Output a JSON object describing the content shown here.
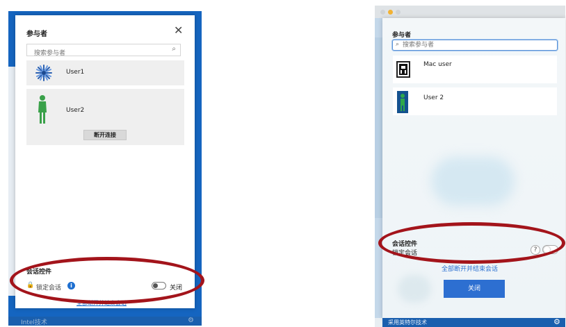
{
  "windows_panel": {
    "title": "参与者",
    "close_glyph": "✕",
    "search": {
      "placeholder": "搜索参与者"
    },
    "participants": [
      {
        "name": "User1",
        "avatar": "snowflake-icon"
      },
      {
        "name": "User2",
        "avatar": "person-icon"
      }
    ],
    "disconnect_label": "断开连接",
    "session_controls": {
      "title": "会话控件",
      "lock_label": "锁定会话",
      "toggle_state": "关闭",
      "end_all_label": "全部断开并结束会话"
    },
    "footer_text": "Intel技术",
    "accent_color": "#1565c0"
  },
  "mac_panel": {
    "title": "参与者",
    "search": {
      "placeholder": "搜索参与者"
    },
    "participants": [
      {
        "name": "Mac user",
        "avatar": "cafe-sign-icon"
      },
      {
        "name": "User 2",
        "avatar": "person-icon"
      }
    ],
    "session_controls": {
      "title": "会话控件",
      "lock_label": "锁定会话",
      "help_glyph": "?",
      "end_all_label": "全部断开并结束会话"
    },
    "close_label": "关闭",
    "footer_text": "采用英特尔技术",
    "accent_color": "#2d6fd1"
  },
  "highlight_color": "#a3141b"
}
